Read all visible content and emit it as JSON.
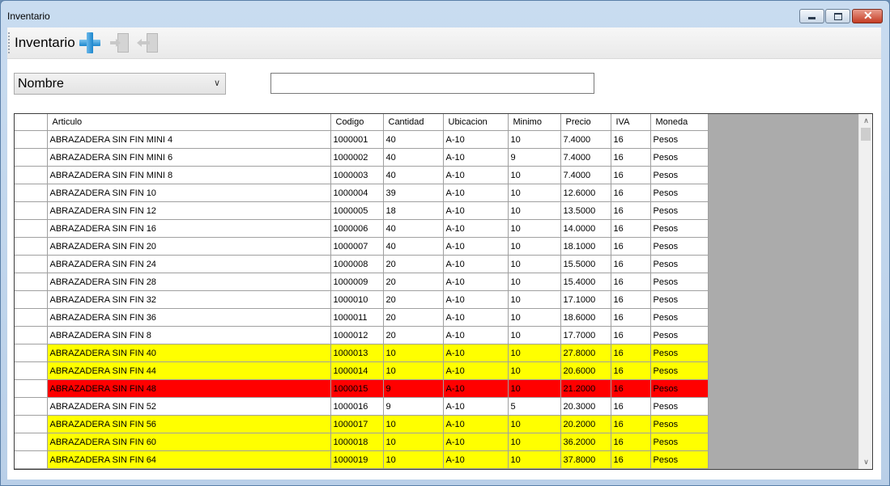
{
  "window": {
    "title": "Inventario"
  },
  "toolbar": {
    "label": "Inventario"
  },
  "filter": {
    "field_selected": "Nombre",
    "search_value": ""
  },
  "grid": {
    "columns": [
      "Articulo",
      "Codigo",
      "Cantidad",
      "Ubicacion",
      "Minimo",
      "Precio",
      "IVA",
      "Moneda"
    ],
    "highlight_colors": {
      "yellow": "#ffff00",
      "red": "#ff0000"
    },
    "rows": [
      {
        "cells": [
          "ABRAZADERA SIN FIN MINI 4",
          "1000001",
          "40",
          "A-10",
          "10",
          "7.4000",
          "16",
          "Pesos"
        ],
        "status": "normal"
      },
      {
        "cells": [
          "ABRAZADERA SIN FIN MINI 6",
          "1000002",
          "40",
          "A-10",
          "9",
          "7.4000",
          "16",
          "Pesos"
        ],
        "status": "normal"
      },
      {
        "cells": [
          "ABRAZADERA SIN FIN MINI 8",
          "1000003",
          "40",
          "A-10",
          "10",
          "7.4000",
          "16",
          "Pesos"
        ],
        "status": "normal"
      },
      {
        "cells": [
          "ABRAZADERA SIN FIN 10",
          "1000004",
          "39",
          "A-10",
          "10",
          "12.6000",
          "16",
          "Pesos"
        ],
        "status": "normal"
      },
      {
        "cells": [
          "ABRAZADERA SIN FIN 12",
          "1000005",
          "18",
          "A-10",
          "10",
          "13.5000",
          "16",
          "Pesos"
        ],
        "status": "normal"
      },
      {
        "cells": [
          "ABRAZADERA SIN FIN 16",
          "1000006",
          "40",
          "A-10",
          "10",
          "14.0000",
          "16",
          "Pesos"
        ],
        "status": "normal"
      },
      {
        "cells": [
          "ABRAZADERA SIN FIN 20",
          "1000007",
          "40",
          "A-10",
          "10",
          "18.1000",
          "16",
          "Pesos"
        ],
        "status": "normal"
      },
      {
        "cells": [
          "ABRAZADERA SIN FIN 24",
          "1000008",
          "20",
          "A-10",
          "10",
          "15.5000",
          "16",
          "Pesos"
        ],
        "status": "normal"
      },
      {
        "cells": [
          "ABRAZADERA SIN FIN 28",
          "1000009",
          "20",
          "A-10",
          "10",
          "15.4000",
          "16",
          "Pesos"
        ],
        "status": "normal"
      },
      {
        "cells": [
          "ABRAZADERA SIN FIN 32",
          "1000010",
          "20",
          "A-10",
          "10",
          "17.1000",
          "16",
          "Pesos"
        ],
        "status": "normal"
      },
      {
        "cells": [
          "ABRAZADERA SIN FIN 36",
          "1000011",
          "20",
          "A-10",
          "10",
          "18.6000",
          "16",
          "Pesos"
        ],
        "status": "normal"
      },
      {
        "cells": [
          "ABRAZADERA SIN FIN 8",
          "1000012",
          "20",
          "A-10",
          "10",
          "17.7000",
          "16",
          "Pesos"
        ],
        "status": "normal"
      },
      {
        "cells": [
          "ABRAZADERA SIN FIN 40",
          "1000013",
          "10",
          "A-10",
          "10",
          "27.8000",
          "16",
          "Pesos"
        ],
        "status": "yellow"
      },
      {
        "cells": [
          "ABRAZADERA SIN FIN 44",
          "1000014",
          "10",
          "A-10",
          "10",
          "20.6000",
          "16",
          "Pesos"
        ],
        "status": "yellow"
      },
      {
        "cells": [
          "ABRAZADERA SIN FIN 48",
          "1000015",
          "9",
          "A-10",
          "10",
          "21.2000",
          "16",
          "Pesos"
        ],
        "status": "red"
      },
      {
        "cells": [
          "ABRAZADERA SIN FIN 52",
          "1000016",
          "9",
          "A-10",
          "5",
          "20.3000",
          "16",
          "Pesos"
        ],
        "status": "normal"
      },
      {
        "cells": [
          "ABRAZADERA SIN FIN 56",
          "1000017",
          "10",
          "A-10",
          "10",
          "20.2000",
          "16",
          "Pesos"
        ],
        "status": "yellow"
      },
      {
        "cells": [
          "ABRAZADERA SIN FIN 60",
          "1000018",
          "10",
          "A-10",
          "10",
          "36.2000",
          "16",
          "Pesos"
        ],
        "status": "yellow"
      },
      {
        "cells": [
          "ABRAZADERA SIN FIN 64",
          "1000019",
          "10",
          "A-10",
          "10",
          "37.8000",
          "16",
          "Pesos"
        ],
        "status": "yellow"
      }
    ]
  }
}
